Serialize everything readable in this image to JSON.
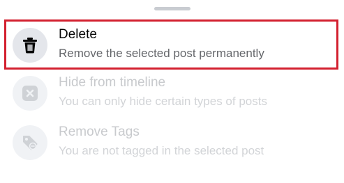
{
  "menu": {
    "items": [
      {
        "title": "Delete",
        "subtitle": "Remove the selected post permanently",
        "icon": "trash-icon",
        "enabled": true
      },
      {
        "title": "Hide from timeline",
        "subtitle": "You can only hide certain types of posts",
        "icon": "hide-x-icon",
        "enabled": false
      },
      {
        "title": "Remove Tags",
        "subtitle": "You are not tagged in the selected post",
        "icon": "tag-icon",
        "enabled": false
      }
    ]
  },
  "colors": {
    "highlight_border": "#d3202f",
    "icon_bg": "#e4e6eb",
    "disabled_text": "#c8cacd"
  }
}
